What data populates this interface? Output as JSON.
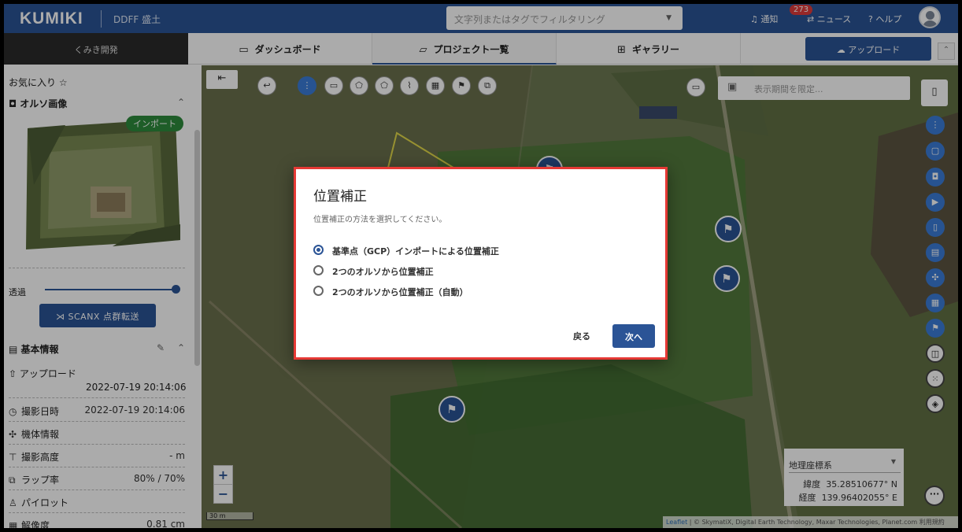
{
  "topbar": {
    "logo": "KUMIKI",
    "project": "DDFF 盛土",
    "filter_placeholder": "文字列またはタグでフィルタリング",
    "notify_label": "通知",
    "notify_count": "273",
    "news_label": "ニュース",
    "help_label": "ヘルプ"
  },
  "navbar": {
    "org": "くみき開発",
    "tabs": [
      {
        "label": "ダッシュボード",
        "icon": "monitor-icon"
      },
      {
        "label": "プロジェクト一覧",
        "icon": "folder-icon"
      },
      {
        "label": "ギャラリー",
        "icon": "grid-icon"
      }
    ],
    "upload_label": "アップロード"
  },
  "sidebar": {
    "favorites": "お気に入り",
    "ortho_title": "オルソ画像",
    "import_badge": "インポート",
    "opacity_label": "透過",
    "opacity_value": 1.0,
    "scanx_label": "SCANX 点群転送",
    "basic_info": "基本情報",
    "upload_label": "アップロード",
    "upload_value": "2022-07-19 20:14:06",
    "rows": [
      {
        "icon": "clock-icon",
        "label": "撮影日時",
        "value": "2022-07-19 20:14:06"
      },
      {
        "icon": "drone-icon",
        "label": "機体情報",
        "value": ""
      },
      {
        "icon": "altitude-icon",
        "label": "撮影高度",
        "value": "- m"
      },
      {
        "icon": "overlap-icon",
        "label": "ラップ率",
        "value": "80% / 70%"
      },
      {
        "icon": "person-icon",
        "label": "パイロット",
        "value": ""
      },
      {
        "icon": "resolution-icon",
        "label": "解像度",
        "value": "0.81 cm"
      }
    ]
  },
  "map": {
    "period_placeholder": "表示期間を限定...",
    "scale": "30 m",
    "coord_system": "地理座標系",
    "lat_label": "緯度",
    "lat_value": "35.28510677° N",
    "lon_label": "経度",
    "lon_value": "139.96402055° E",
    "attribution_leaflet": "Leaflet",
    "attribution_rest": " | © SkymatiX, Digital Earth Technology, Maxar Technologies, Planet.com 利用規約"
  },
  "dialog": {
    "title": "位置補正",
    "subtitle": "位置補正の方法を選択してください。",
    "options": [
      {
        "label": "基準点（GCP）インポートによる位置補正",
        "selected": true
      },
      {
        "label": "2つのオルソから位置補正",
        "selected": false
      },
      {
        "label": "2つのオルソから位置補正（自動）",
        "selected": false
      }
    ],
    "back_label": "戻る",
    "next_label": "次へ"
  },
  "colors": {
    "brand": "#2b5496",
    "highlight": "#e53935",
    "import_badge": "#2e8b3d"
  }
}
